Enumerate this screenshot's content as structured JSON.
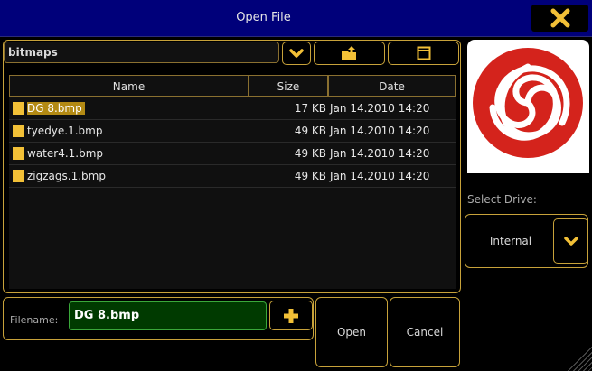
{
  "window": {
    "title": "Open File"
  },
  "toolbar": {
    "path": "bitmaps"
  },
  "table": {
    "columns": [
      "Name",
      "Size",
      "Date"
    ],
    "rows": [
      {
        "name": "DG 8.bmp",
        "size": "17 KB",
        "date": "Jan 14.2010 14:20",
        "selected": true
      },
      {
        "name": "tyedye.1.bmp",
        "size": "49 KB",
        "date": "Jan 14.2010 14:20",
        "selected": false
      },
      {
        "name": "water4.1.bmp",
        "size": "49 KB",
        "date": "Jan 14.2010 14:20",
        "selected": false
      },
      {
        "name": "zigzags.1.bmp",
        "size": "49 KB",
        "date": "Jan 14.2010 14:20",
        "selected": false
      }
    ]
  },
  "drive": {
    "label": "Select Drive:",
    "value": "Internal"
  },
  "filename": {
    "label": "Filename:",
    "value": "DG 8.bmp"
  },
  "buttons": {
    "open": "Open",
    "cancel": "Cancel"
  },
  "colors": {
    "titlebar": "#00007a",
    "accent": "#f2c037",
    "border": "#c7a23a",
    "preview_swirl": "#d4231c"
  },
  "icons": {
    "close": "close-icon",
    "dropdown": "chevron-down-icon",
    "folder_up": "folder-up-icon",
    "window": "window-icon",
    "file": "file-icon",
    "add": "plus-icon"
  }
}
